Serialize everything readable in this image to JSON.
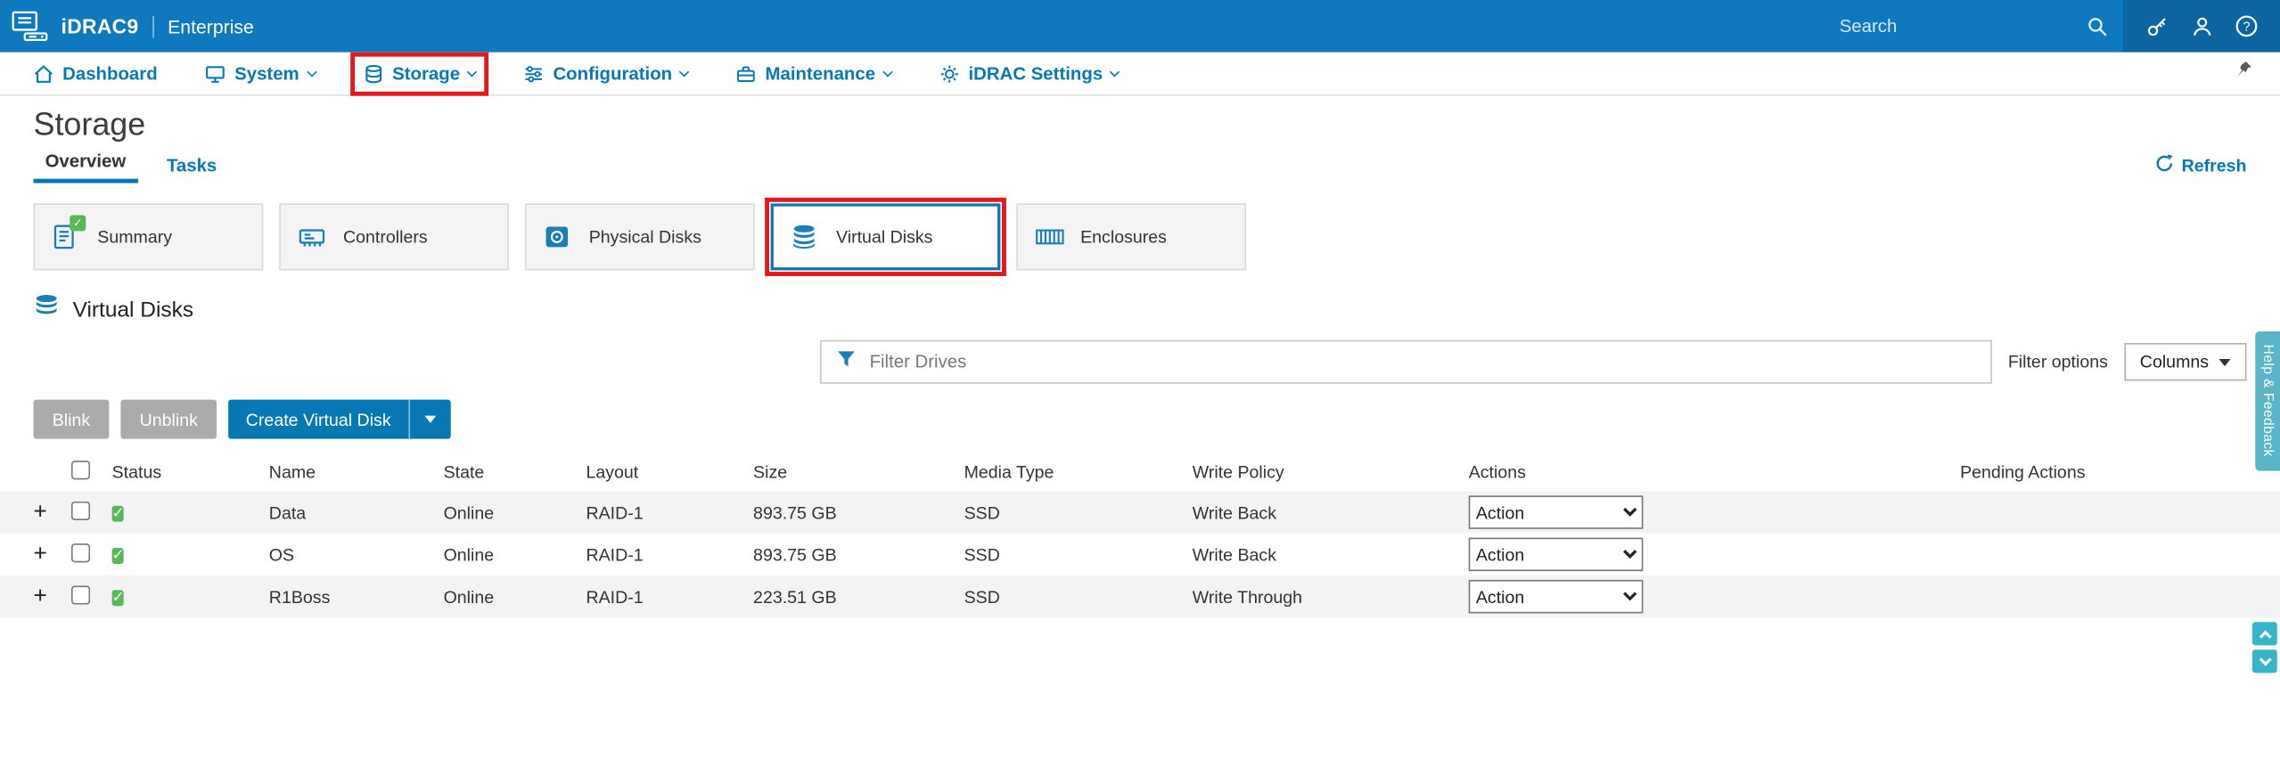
{
  "topbar": {
    "product": "iDRAC9",
    "edition": "Enterprise",
    "search_placeholder": "Search"
  },
  "nav": {
    "items": [
      {
        "label": "Dashboard",
        "icon": "home-icon",
        "dropdown": false
      },
      {
        "label": "System",
        "icon": "system-icon",
        "dropdown": true
      },
      {
        "label": "Storage",
        "icon": "storage-icon",
        "dropdown": true,
        "annotated": true
      },
      {
        "label": "Configuration",
        "icon": "configuration-icon",
        "dropdown": true
      },
      {
        "label": "Maintenance",
        "icon": "maintenance-icon",
        "dropdown": true
      },
      {
        "label": "iDRAC Settings",
        "icon": "settings-gear-icon",
        "dropdown": true
      }
    ]
  },
  "page": {
    "title": "Storage",
    "tabs": [
      {
        "label": "Overview",
        "active": true
      },
      {
        "label": "Tasks",
        "active": false
      }
    ],
    "refresh_label": "Refresh"
  },
  "cards": [
    {
      "label": "Summary",
      "icon": "summary-report-icon",
      "badge": "green-check"
    },
    {
      "label": "Controllers",
      "icon": "controller-card-icon"
    },
    {
      "label": "Physical Disks",
      "icon": "physical-disk-icon"
    },
    {
      "label": "Virtual Disks",
      "icon": "virtual-disks-icon",
      "selected": true,
      "annotated": true
    },
    {
      "label": "Enclosures",
      "icon": "enclosure-icon"
    }
  ],
  "section": {
    "title": "Virtual Disks"
  },
  "filter": {
    "placeholder": "Filter Drives",
    "options_label": "Filter options",
    "columns_label": "Columns"
  },
  "toolbar": {
    "blink_label": "Blink",
    "unblink_label": "Unblink",
    "create_label": "Create Virtual Disk"
  },
  "table": {
    "columns": [
      "Status",
      "Name",
      "State",
      "Layout",
      "Size",
      "Media Type",
      "Write Policy",
      "Actions",
      "Pending Actions"
    ],
    "rows": [
      {
        "status": "OK",
        "name": "Data",
        "state": "Online",
        "layout": "RAID-1",
        "size": "893.75 GB",
        "media_type": "SSD",
        "write_policy": "Write Back",
        "action": "Action",
        "pending_actions": ""
      },
      {
        "status": "OK",
        "name": "OS",
        "state": "Online",
        "layout": "RAID-1",
        "size": "893.75 GB",
        "media_type": "SSD",
        "write_policy": "Write Back",
        "action": "Action",
        "pending_actions": ""
      },
      {
        "status": "OK",
        "name": "R1Boss",
        "state": "Online",
        "layout": "RAID-1",
        "size": "223.51 GB",
        "media_type": "SSD",
        "write_policy": "Write Through",
        "action": "Action",
        "pending_actions": ""
      }
    ]
  },
  "help_tab": {
    "label": "Help & Feedback"
  },
  "colors": {
    "topbar_blue": "#0f79c0",
    "accent_blue": "#0878b4",
    "annotation_red": "#e3191d",
    "status_green": "#58b857",
    "help_tab_teal": "#5ab6c6",
    "disabled_gray": "#ababab"
  }
}
